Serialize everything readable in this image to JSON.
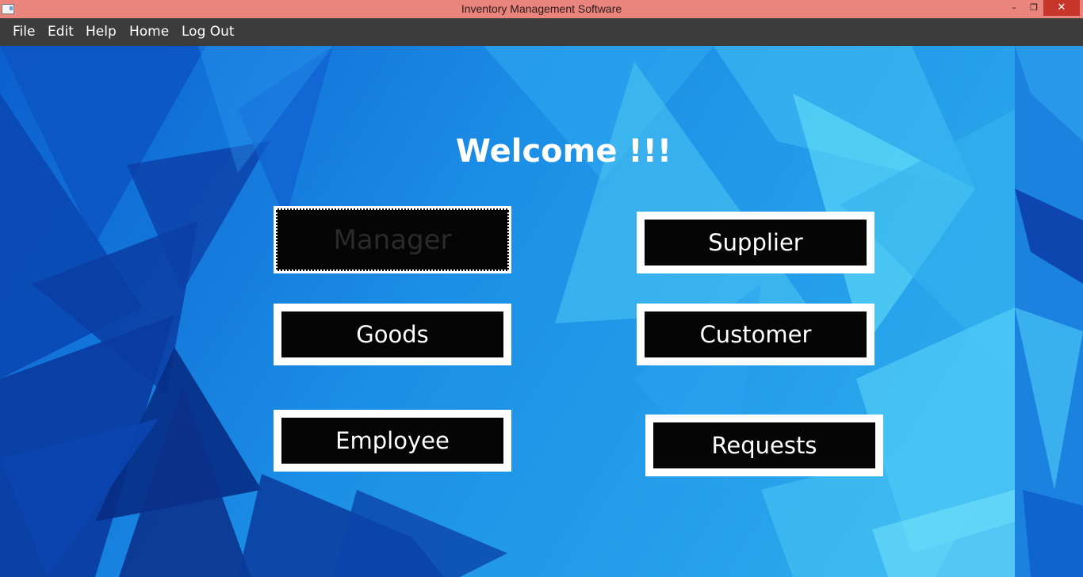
{
  "window": {
    "title": "Inventory Management Software",
    "controls": {
      "minimize": "–",
      "maximize": "❐",
      "close": "✕"
    }
  },
  "menubar": {
    "items": [
      "File",
      "Edit",
      "Help",
      "Home",
      "Log Out"
    ]
  },
  "main": {
    "heading": "Welcome !!!",
    "buttons": {
      "manager": "Manager",
      "supplier": "Supplier",
      "goods": "Goods",
      "customer": "Customer",
      "employee": "Employee",
      "requests": "Requests"
    }
  },
  "colors": {
    "titlebar": "#e9857c",
    "menubar": "#3c3c3c",
    "background_blue": "#1a7fdc",
    "button_fill": "#050505",
    "button_border": "#ffffff"
  }
}
